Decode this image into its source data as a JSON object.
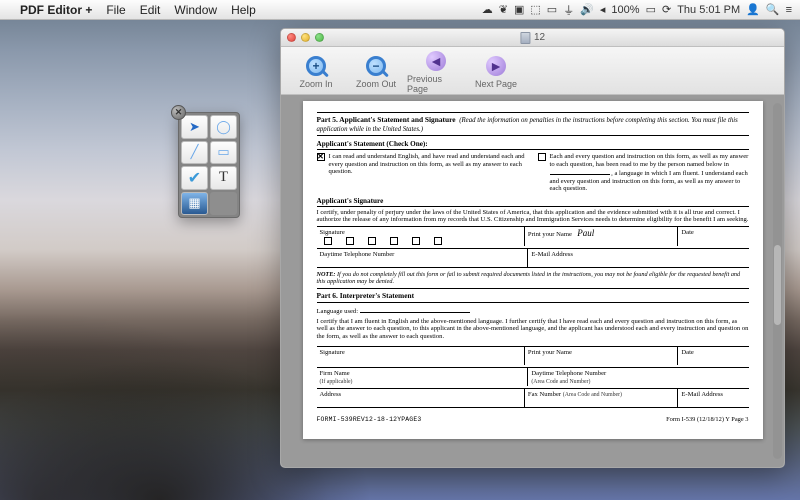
{
  "menubar": {
    "app_name": "PDF Editor +",
    "items": [
      "File",
      "Edit",
      "Window",
      "Help"
    ],
    "battery": "100%",
    "clock": "Thu 5:01 PM"
  },
  "window": {
    "title": "12"
  },
  "toolbar": {
    "zoom_in": "Zoom In",
    "zoom_out": "Zoom Out",
    "prev_page": "Previous Page",
    "next_page": "Next Page"
  },
  "palette": {
    "tools": [
      "pointer",
      "ellipse",
      "line",
      "rectangle",
      "checkmark",
      "text",
      "image",
      ""
    ]
  },
  "doc": {
    "part5_header": "Part 5.  Applicant's Statement and Signature",
    "part5_instr": "(Read the information on penalties in the instructions before completing this section. You must file this application while in the United States.)",
    "applicant_stmt_head": "Applicant's Statement (Check One):",
    "stmt_opt1": "I can read and understand English, and have read and understand each and every question and instruction on this form, as well as my answer to each question.",
    "stmt_opt2_a": "Each and every question and instruction on this form, as well as my answer to each question, has been read to me by the person named below in",
    "stmt_opt2_b": ", a language in which I am fluent. I understand each and every question and instruction on this form, as well as my answer to each question.",
    "app_sig_head": "Applicant's Signature",
    "cert_text": "I certify, under penalty of perjury under the laws of the United States of America, that this application and the evidence submitted with it is all true and correct.  I authorize the release of any information from my records that U.S. Citizenship and Immigration Services needs to determine eligibility for the benefit I am seeking.",
    "signature_label": "Signature",
    "print_name_label": "Print your Name",
    "print_name_value": "Paul",
    "date_label": "Date",
    "daytime_tel_label": "Daytime Telephone Number",
    "email_label": "E-Mail Address",
    "note_label": "NOTE:",
    "note_text": "If you do not completely fill out this form or fail to submit required documents listed in the instructions, you may not be found eligible for the requested benefit and this application may be denied.",
    "part6_header": "Part 6.  Interpreter's Statement",
    "lang_used_label": "Language used:",
    "interp_cert": "I certify that I am fluent in English and the above-mentioned language. I further certify that I have read each and every question and instruction on this form, as well as the answer to each question, to this applicant in the above-mentioned language, and the applicant has understood each and every instruction and question on the form, as well as the answer to each question.",
    "firm_label": "Firm Name",
    "firm_sub": "(If applicable)",
    "daytime_tel2": "Daytime Telephone Number",
    "area_code": "(Area Code and Number)",
    "address_label": "Address",
    "fax_label": "Fax Number",
    "form_id": "FORMI-539REV12-18-12YPAGE3",
    "footer_right": "Form I-539  (12/18/12) Y  Page 3"
  }
}
